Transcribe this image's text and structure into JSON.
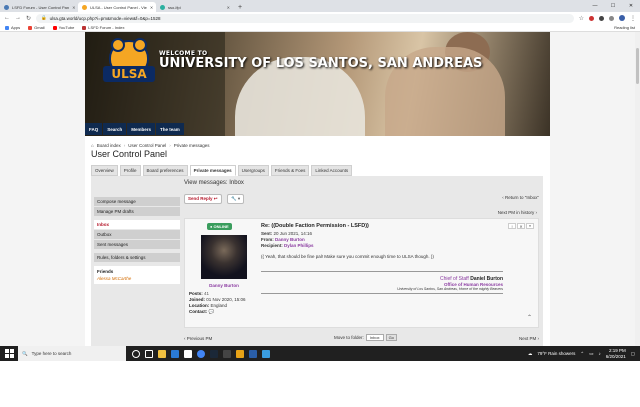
{
  "browser": {
    "tabs": [
      {
        "label": "LSFD Forum - User Control Pan",
        "active": false
      },
      {
        "label": "ULSA - User Control Panel - Vie",
        "active": true
      },
      {
        "label": "sso-lfpi",
        "active": false
      }
    ],
    "new_tab": "+",
    "url": "ulsa.gta.world/ucp.php?i=pm&mode=view&f=0&p=1528",
    "bookmarks": [
      "Apps",
      "Gmail",
      "YouTube",
      "LSFD Forum - Index"
    ],
    "reading_list": "Reading list"
  },
  "banner": {
    "welcome": "WELCOME TO",
    "university": "UNIVERSITY OF LOS SANTOS, SAN ANDREAS",
    "logo_text": "ULSA"
  },
  "topnav": [
    "FAQ",
    "Search",
    "Members",
    "The team"
  ],
  "breadcrumbs": [
    "Board index",
    "User Control Panel",
    "Private messages"
  ],
  "page_title": "User Control Panel",
  "ucp_tabs": [
    {
      "label": "Overview",
      "active": false
    },
    {
      "label": "Profile",
      "active": false
    },
    {
      "label": "Board preferences",
      "active": false
    },
    {
      "label": "Private messages",
      "active": true
    },
    {
      "label": "Usergroups",
      "active": false
    },
    {
      "label": "Friends & Foes",
      "active": false
    },
    {
      "label": "Linked Accounts",
      "active": false
    }
  ],
  "sidebar": {
    "group1": [
      "Compose message",
      "Manage PM drafts"
    ],
    "group2": [
      "Inbox",
      "Outbox",
      "Sent messages"
    ],
    "group3": [
      "Rules, folders & settings"
    ],
    "friends_label": "Friends",
    "friend": "Alessa McCarthe"
  },
  "view_header": "View messages: Inbox",
  "send_reply": "Send Reply",
  "return_to": "Return to \"Inbox\"",
  "next_pm_history": "Next PM in history",
  "post": {
    "status": "ONLINE",
    "author": "Danny Burton",
    "meta_posts_label": "Posts:",
    "meta_posts": "41",
    "meta_joined_label": "Joined:",
    "meta_joined": "01 Nov 2020, 15:06",
    "meta_location_label": "Location:",
    "meta_location": "England",
    "meta_contact_label": "Contact:",
    "title": "Re: ((Double Faction Permission - LSFD))",
    "sent_label": "Sent:",
    "sent": "20 Jun 2021, 14:16",
    "from_label": "From:",
    "from": "Danny Burton",
    "recipient_label": "Recipient:",
    "recipient": "Dylan Phillips",
    "message": "(( Yeah, that should be fine pal! Make sure you commit enough time to ULSA though. ))",
    "sig_role": "Chief of Staff",
    "sig_name": "Daniel Burton",
    "sig_office": "Office of Human Resources",
    "sig_univ": "University of Los Santos, San Andreas, Home of the mighty Beavers"
  },
  "previous_pm": "Previous PM",
  "move_label": "Move to folder:",
  "move_select": "Inbox",
  "go": "Go",
  "next_pm": "Next PM",
  "taskbar": {
    "search_placeholder": "Type here to search",
    "weather": "79°F  Rain showers",
    "time": "2:19 PM",
    "date": "6/20/2021"
  }
}
